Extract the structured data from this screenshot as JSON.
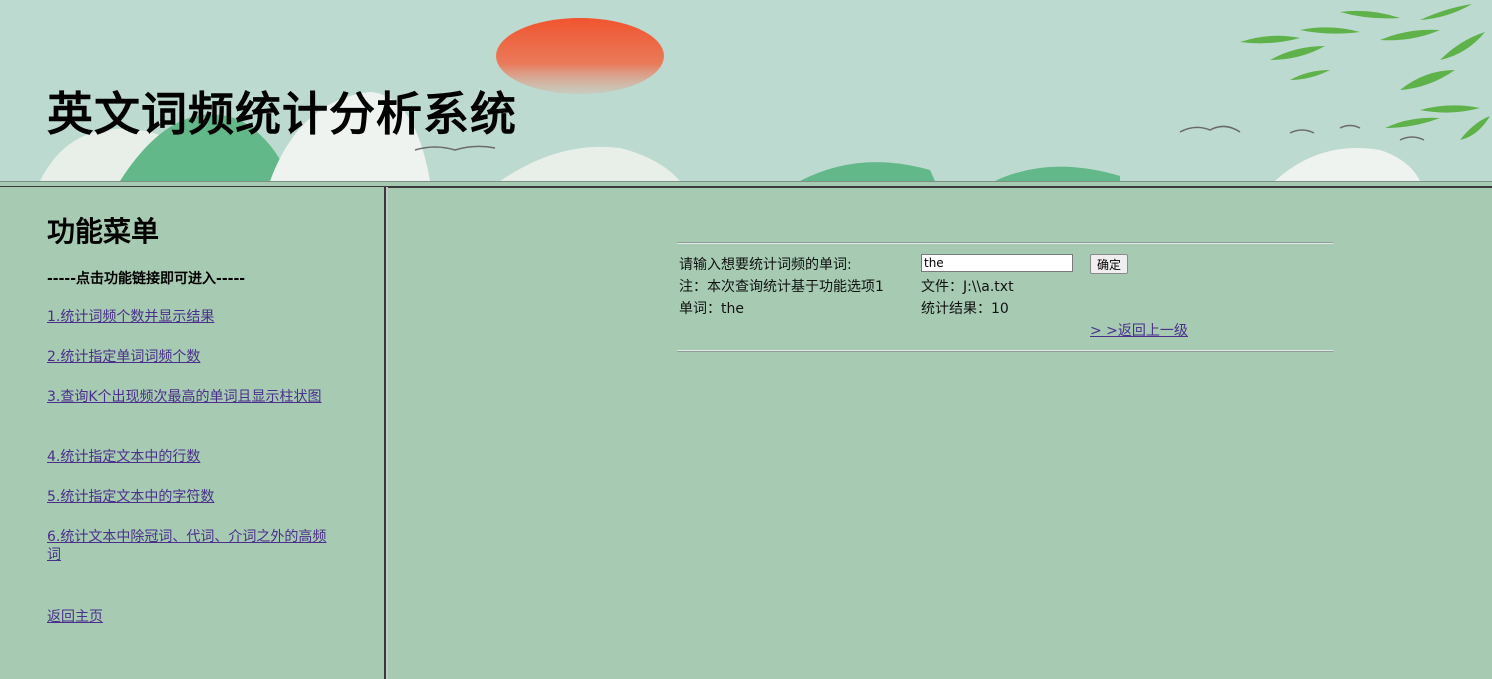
{
  "header": {
    "title": "英文词频统计分析系统"
  },
  "sidebar": {
    "title": "功能菜单",
    "hint": "-----点击功能链接即可进入-----",
    "items": [
      {
        "label": "1.统计词频个数并显示结果"
      },
      {
        "label": "2.统计指定单词词频个数"
      },
      {
        "label": "3.查询K个出现频次最高的单词且显示柱状图"
      },
      {
        "label": "4.统计指定文本中的行数"
      },
      {
        "label": "5.统计指定文本中的字符数"
      },
      {
        "label": "6.统计文本中除冠词、代词、介词之外的高频词"
      }
    ],
    "home_link": "返回主页"
  },
  "form": {
    "prompt_label": "请输入想要统计词频的单词:",
    "word_value": "the",
    "confirm_label": "确定",
    "note_label": "注：本次查询统计基于功能选项1",
    "file_label": "文件：J:\\\\a.txt",
    "word_result_label": "单词：the",
    "count_result_label": "统计结果：10",
    "back_label": "> >返回上一级"
  },
  "colors": {
    "background": "#a6cbb2",
    "header_background": "#bcdad0",
    "link": "#4b2f8c",
    "sun": "#e8553a"
  }
}
